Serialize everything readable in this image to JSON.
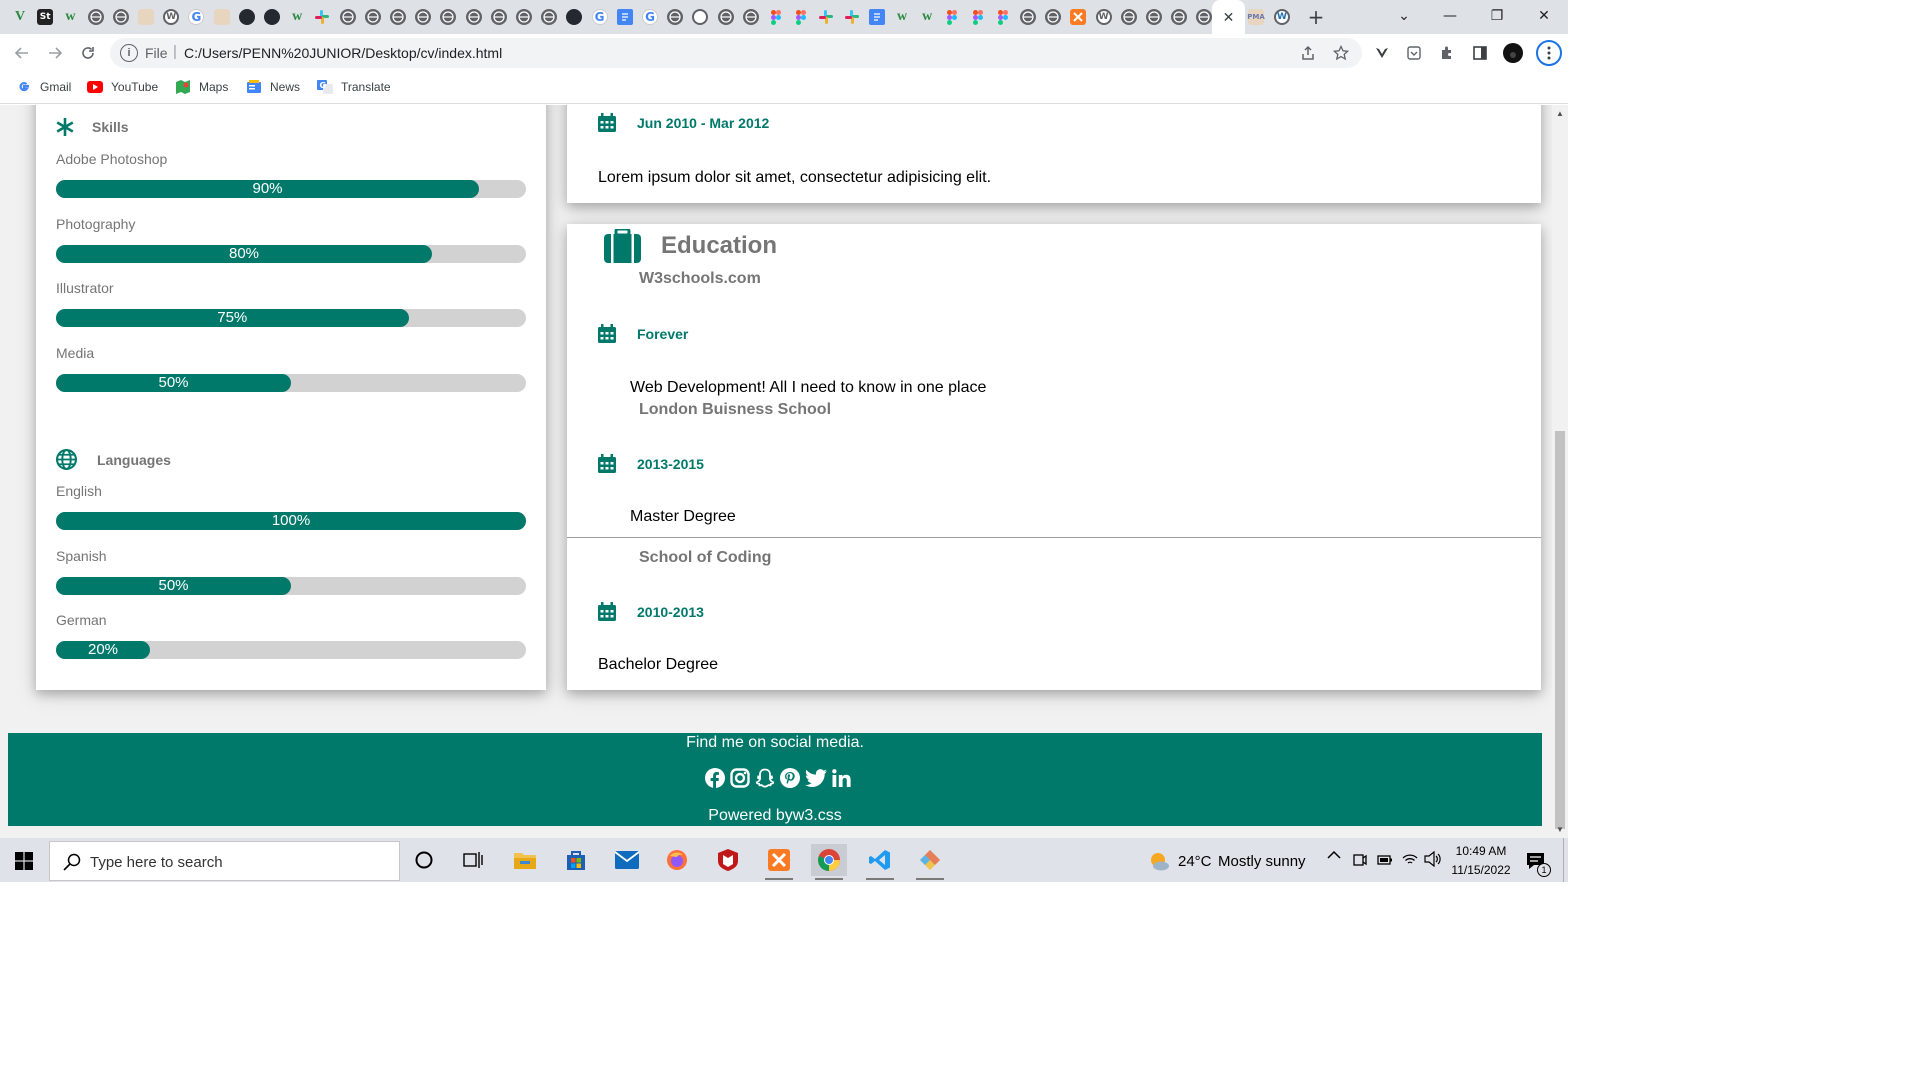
{
  "browser": {
    "active_tab_close": "✕",
    "new_tab": "+",
    "window_controls": {
      "dropdown": "⌄",
      "minimize": "—",
      "maximize": "❐",
      "close": "✕"
    },
    "address": {
      "scheme": "File",
      "separator": "|",
      "url": "C:/Users/PENN%20JUNIOR/Desktop/cv/index.html"
    },
    "tab_favicons": [
      {
        "icon": "vuetify-icon",
        "label": "V"
      },
      {
        "icon": "studio-icon",
        "label": "St"
      },
      {
        "icon": "webflow-icon",
        "label": "w"
      },
      {
        "icon": "globe-icon",
        "label": ""
      },
      {
        "icon": "globe-icon",
        "label": ""
      },
      {
        "icon": "pma-icon",
        "label": ""
      },
      {
        "icon": "wordpress-icon",
        "label": "W"
      },
      {
        "icon": "google-icon",
        "label": "G"
      },
      {
        "icon": "pma-icon",
        "label": ""
      },
      {
        "icon": "openai-icon",
        "label": ""
      },
      {
        "icon": "github-icon",
        "label": ""
      },
      {
        "icon": "webflow-icon",
        "label": "w"
      },
      {
        "icon": "slack-icon",
        "label": ""
      },
      {
        "icon": "globe-icon",
        "label": ""
      },
      {
        "icon": "globe-icon",
        "label": ""
      },
      {
        "icon": "globe-icon",
        "label": ""
      },
      {
        "icon": "globe-icon",
        "label": ""
      },
      {
        "icon": "globe-icon",
        "label": ""
      },
      {
        "icon": "globe-icon",
        "label": ""
      },
      {
        "icon": "globe-icon",
        "label": ""
      },
      {
        "icon": "globe-icon",
        "label": ""
      },
      {
        "icon": "globe-icon",
        "label": ""
      },
      {
        "icon": "openai-icon",
        "label": ""
      },
      {
        "icon": "google-icon",
        "label": "G"
      },
      {
        "icon": "docs-icon",
        "label": ""
      },
      {
        "icon": "google-icon",
        "label": "G"
      },
      {
        "icon": "globe-icon",
        "label": ""
      },
      {
        "icon": "blank-icon",
        "label": ""
      },
      {
        "icon": "globe-icon",
        "label": ""
      },
      {
        "icon": "globe-icon",
        "label": ""
      },
      {
        "icon": "figma-icon",
        "label": ""
      },
      {
        "icon": "figma-icon",
        "label": ""
      },
      {
        "icon": "slack-icon",
        "label": ""
      },
      {
        "icon": "slack-icon",
        "label": ""
      },
      {
        "icon": "docs-icon",
        "label": ""
      },
      {
        "icon": "webflow-icon",
        "label": "w"
      },
      {
        "icon": "webflow-icon",
        "label": "w"
      },
      {
        "icon": "figma-icon",
        "label": ""
      },
      {
        "icon": "figma-icon",
        "label": ""
      },
      {
        "icon": "figma-icon",
        "label": ""
      },
      {
        "icon": "globe-icon",
        "label": ""
      },
      {
        "icon": "globe-icon",
        "label": ""
      },
      {
        "icon": "xampp-icon",
        "label": ""
      },
      {
        "icon": "wordpress-icon",
        "label": "W"
      },
      {
        "icon": "globe-icon",
        "label": ""
      },
      {
        "icon": "globe-icon",
        "label": ""
      },
      {
        "icon": "globe-icon",
        "label": ""
      },
      {
        "icon": "globe-icon",
        "label": ""
      }
    ],
    "after_active_tabs": [
      {
        "icon": "pma-icon",
        "label": "PMA"
      },
      {
        "icon": "wordpress-icon",
        "label": "W"
      }
    ],
    "bookmarks": [
      {
        "label": "Gmail",
        "icon": "gmail-icon"
      },
      {
        "label": "YouTube",
        "icon": "youtube-icon"
      },
      {
        "label": "Maps",
        "icon": "maps-icon"
      },
      {
        "label": "News",
        "icon": "news-icon"
      },
      {
        "label": "Translate",
        "icon": "translate-icon"
      }
    ]
  },
  "page": {
    "skills": {
      "title": "Skills",
      "items": [
        {
          "name": "Adobe Photoshop",
          "percent": 90,
          "label": "90%"
        },
        {
          "name": "Photography",
          "percent": 80,
          "label": "80%"
        },
        {
          "name": "Illustrator",
          "percent": 75,
          "label": "75%"
        },
        {
          "name": "Media",
          "percent": 50,
          "label": "50%"
        }
      ]
    },
    "languages": {
      "title": "Languages",
      "items": [
        {
          "name": "English",
          "percent": 100,
          "label": "100%"
        },
        {
          "name": "Spanish",
          "percent": 50,
          "label": "50%"
        },
        {
          "name": "German",
          "percent": 20,
          "label": "20%"
        }
      ]
    },
    "work_tail": {
      "date": "Jun 2010 - Mar 2012",
      "text": "Lorem ipsum dolor sit amet, consectetur adipisicing elit."
    },
    "education": {
      "title": "Education",
      "entries": [
        {
          "school": "W3schools.com",
          "date": "Forever",
          "text": "Web Development! All I need to know in one place"
        },
        {
          "school": "London Buisness School",
          "date": "2013-2015",
          "text": "Master Degree"
        },
        {
          "school": "School of Coding",
          "date": "2010-2013",
          "text": "Bachelor Degree"
        }
      ]
    },
    "footer": {
      "tagline": "Find me on social media.",
      "powered": "Powered byw3.css",
      "social_icons": [
        "facebook-icon",
        "instagram-icon",
        "snapchat-icon",
        "pinterest-icon",
        "twitter-icon",
        "linkedin-icon"
      ]
    },
    "accent_color": "#00796b"
  },
  "taskbar": {
    "search_placeholder": "Type here to search",
    "weather": {
      "temp": "24°C",
      "condition": "Mostly sunny"
    },
    "time": "10:49 AM",
    "date": "11/15/2022",
    "notifications_count": "1",
    "apps": [
      "cortana-icon",
      "task-view-icon",
      "file-explorer-icon",
      "store-icon",
      "mail-icon",
      "firefox-icon",
      "mcafee-icon",
      "xampp-icon",
      "chrome-icon",
      "vscode-icon",
      "git-icon"
    ]
  }
}
